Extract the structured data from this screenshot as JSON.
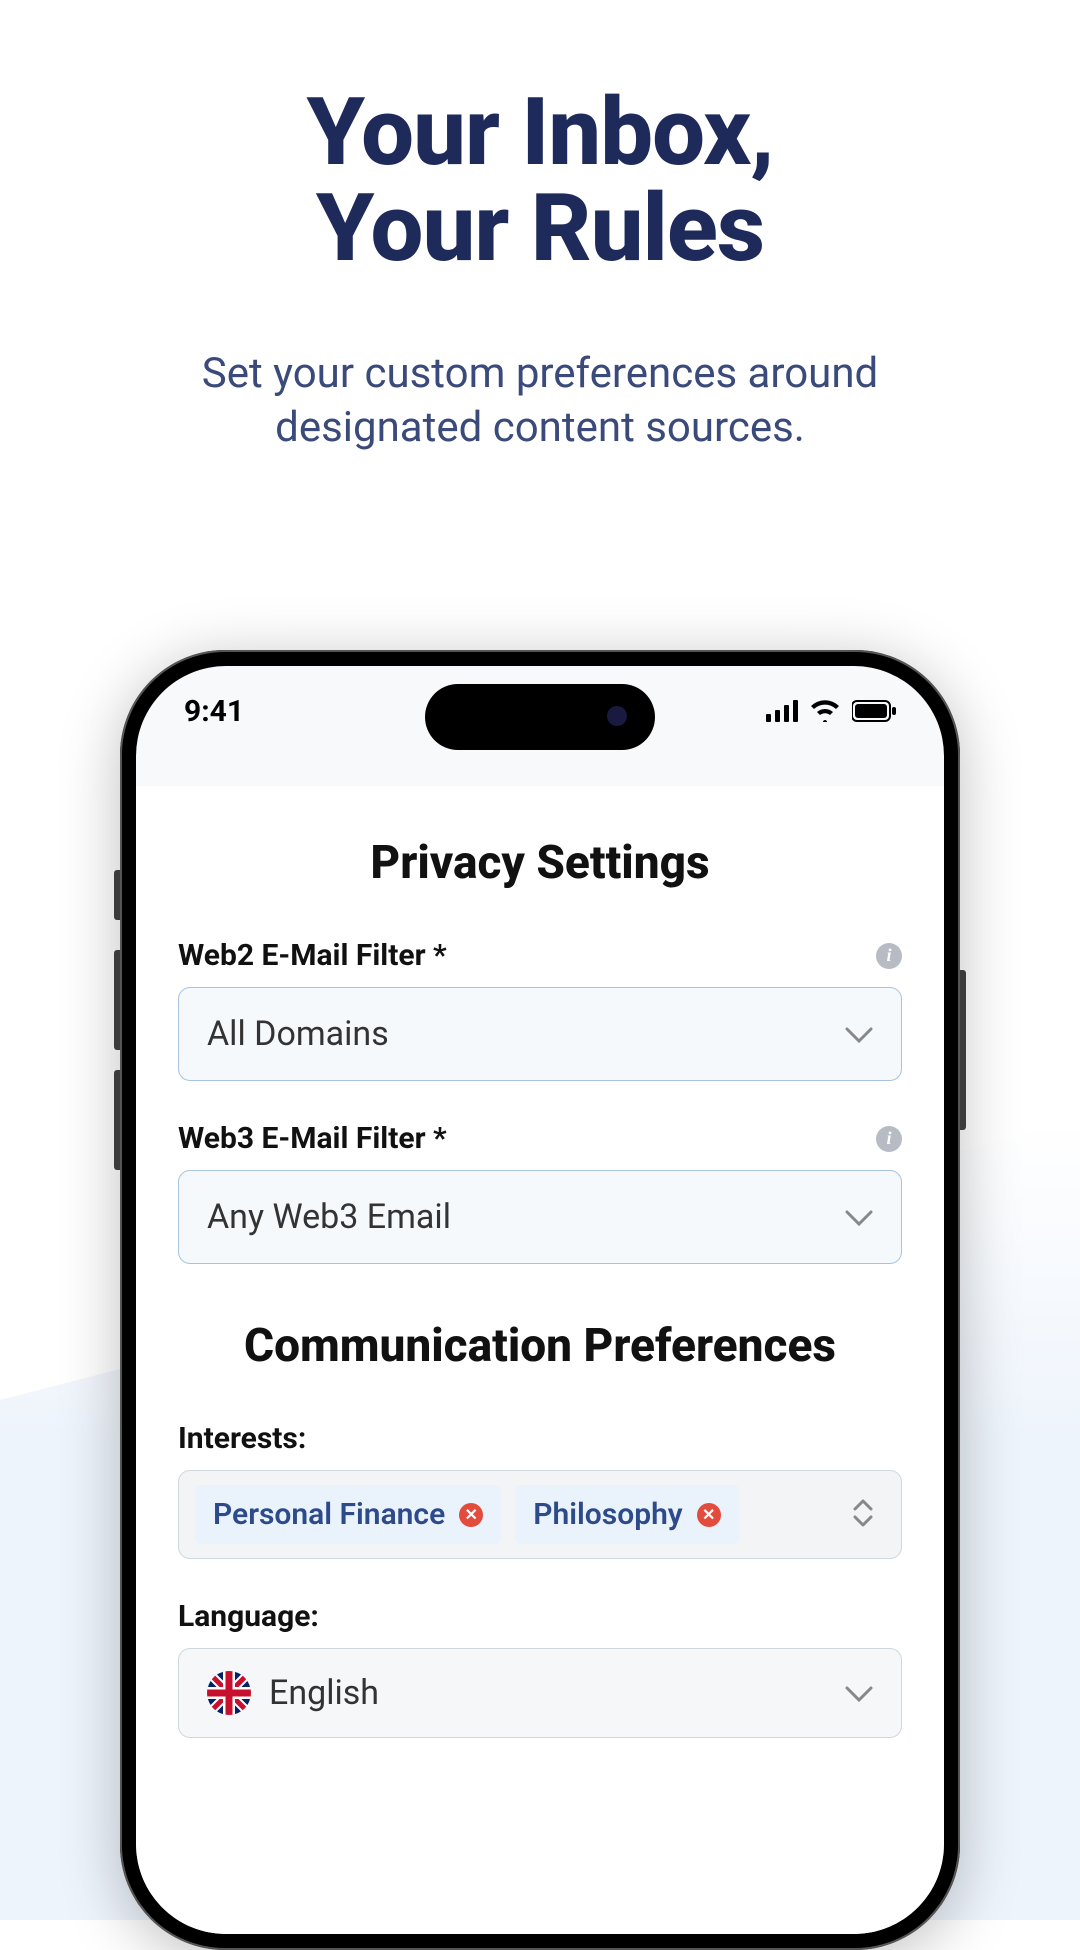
{
  "hero": {
    "title_line1": "Your Inbox,",
    "title_line2": "Your Rules",
    "subtitle_line1": "Set your custom preferences around",
    "subtitle_line2": "designated content sources."
  },
  "status": {
    "time": "9:41"
  },
  "privacy": {
    "title": "Privacy Settings",
    "web2": {
      "label": "Web2 E-Mail Filter *",
      "value": "All Domains"
    },
    "web3": {
      "label": "Web3 E-Mail Filter *",
      "value": "Any Web3 Email"
    }
  },
  "comm": {
    "title": "Communication Preferences",
    "interests_label": "Interests:",
    "interests": [
      "Personal Finance",
      "Philosophy"
    ],
    "language_label": "Language:",
    "language_value": "English"
  }
}
